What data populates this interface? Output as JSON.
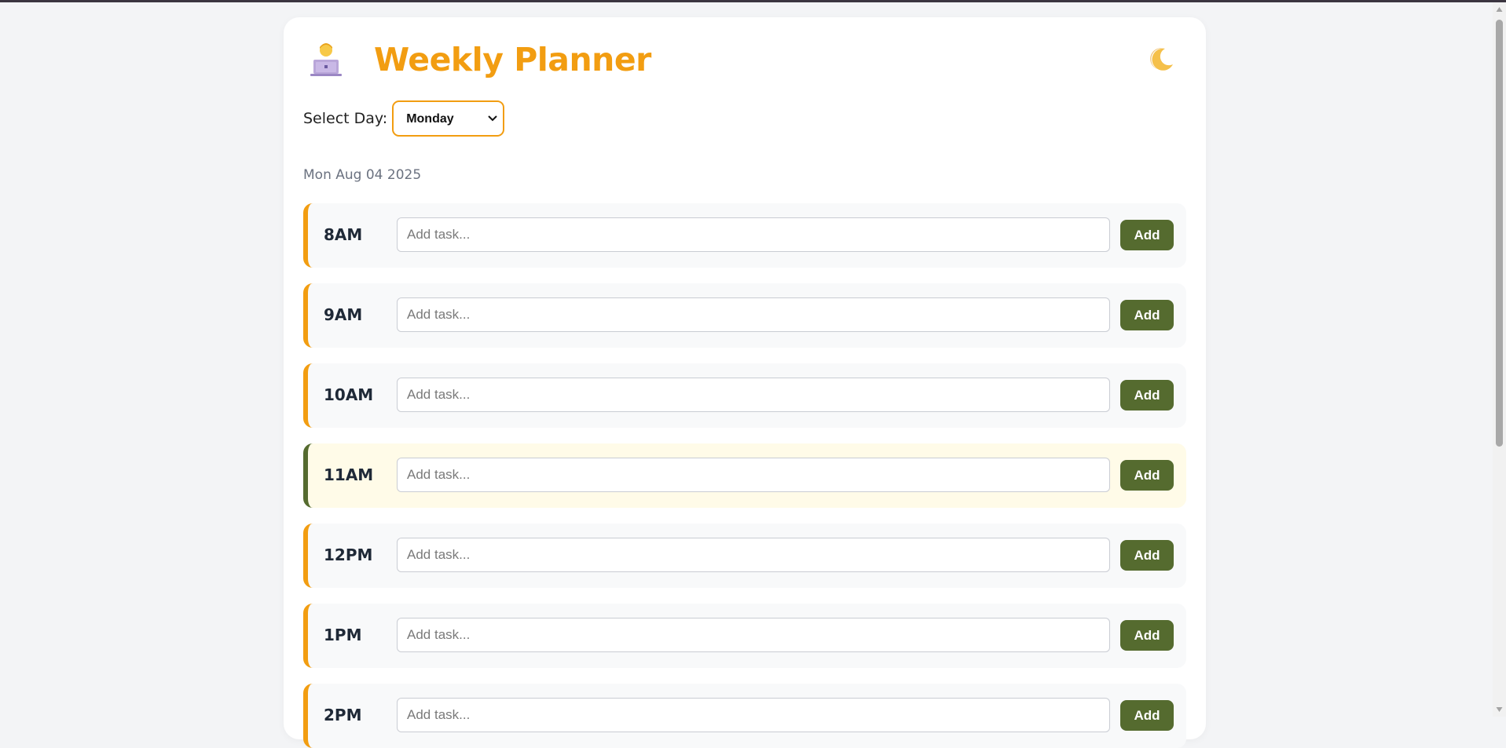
{
  "header": {
    "title": "Weekly Planner",
    "person_icon": "person-laptop-icon",
    "theme_icon": "moon-icon"
  },
  "day_select": {
    "label": "Select Day:",
    "value": "Monday"
  },
  "date_text": "Mon Aug 04 2025",
  "input_placeholder": "Add task...",
  "add_label": "Add",
  "slots": [
    {
      "time": "8AM",
      "current": false
    },
    {
      "time": "9AM",
      "current": false
    },
    {
      "time": "10AM",
      "current": false
    },
    {
      "time": "11AM",
      "current": true
    },
    {
      "time": "12PM",
      "current": false
    },
    {
      "time": "1PM",
      "current": false
    },
    {
      "time": "2PM",
      "current": false
    }
  ],
  "colors": {
    "accent": "#f29d11",
    "button": "#556b2f",
    "current_bg": "#fffbe8",
    "page_bg": "#f3f4f6"
  }
}
